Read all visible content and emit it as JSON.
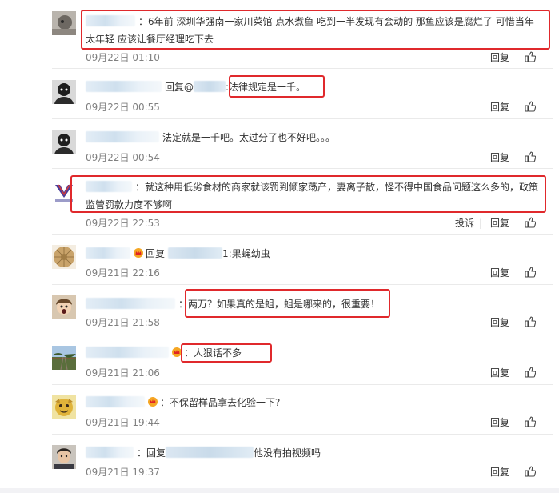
{
  "actions": {
    "reply": "回复",
    "report": "投诉",
    "reply_prefix": "回复@"
  },
  "highlight_color": "#e0292c",
  "comments": [
    {
      "text": "：6年前 深圳华强南一家川菜馆 点水煮鱼 吃到一半发现有会动的 那鱼应该是腐烂了 可惜当年太年轻 应该让餐厅经理吃下去",
      "time": "09月22日 01:10"
    },
    {
      "text": ":法律规定是一千。",
      "time": "09月22日 00:55"
    },
    {
      "text": "法定就是一千吧。太过分了也不好吧。。。",
      "time": "09月22日 00:54"
    },
    {
      "text": "：就这种用低劣食材的商家就该罚到倾家荡产，妻离子散，怪不得中国食品问题这么多的，政策监管罚款力度不够啊",
      "time": "09月22日 22:53"
    },
    {
      "text": "1:果蝇幼虫",
      "time": "09月21日 22:16"
    },
    {
      "text": "：两万？如果真的是蛆，蛆是哪来的，很重要！",
      "time": "09月21日 21:58"
    },
    {
      "text": "：人狠话不多",
      "time": "09月21日 21:06"
    },
    {
      "text": "：不保留样品拿去化验一下?",
      "time": "09月21日 19:44"
    },
    {
      "text": "他没有拍视频吗",
      "time": "09月21日 19:37"
    }
  ]
}
